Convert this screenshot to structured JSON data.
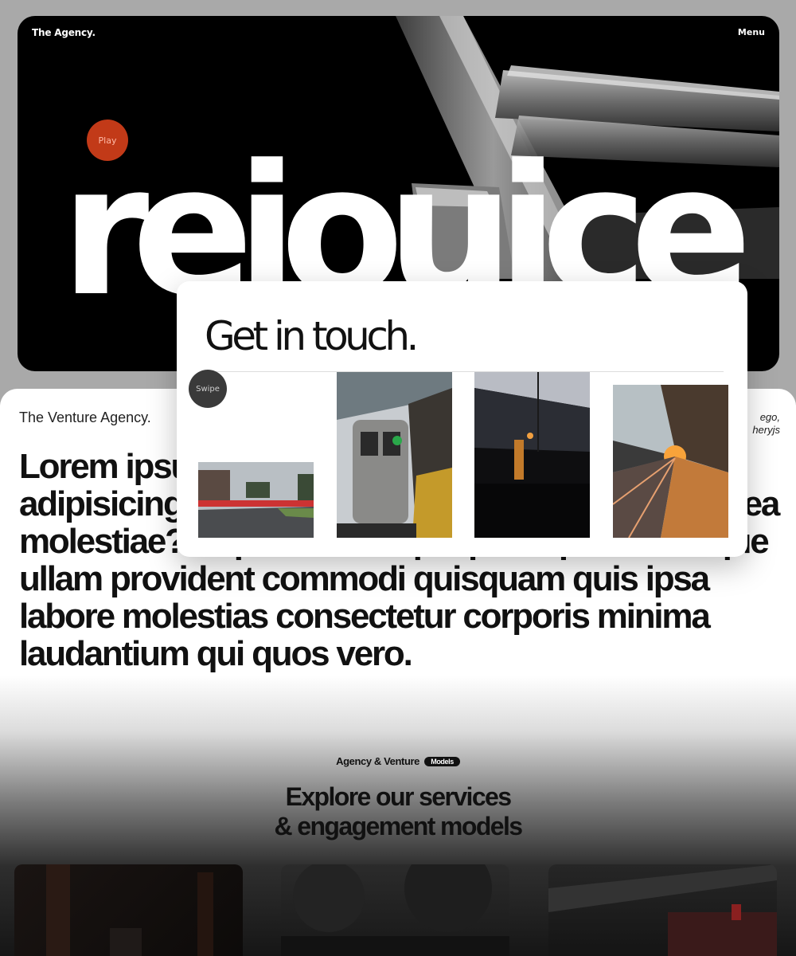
{
  "hero": {
    "logo": "The Agency.",
    "menu_label": "Menu",
    "play_label": "Play",
    "word": "rejouice"
  },
  "intro": {
    "venture_title": "The Venture Agency.",
    "side_note_line1": "ego,",
    "side_note_line2": "heryjs",
    "lead_text": "Lorem ipsum dolor sit amet consectetur adipisicing elit. Dolorem ratione veniam eveniet, ea molestiae? Repudiandae quo porro placeat itaque ullam provident commodi quisquam quis ipsa labore molestias consectetur corporis minima laudantium qui quos vero."
  },
  "services": {
    "tagline": "Agency & Venture",
    "badge": "Models",
    "heading_line1": "Explore our services",
    "heading_line2": "& engagement models"
  },
  "contact": {
    "title": "Get in touch.",
    "swipe_label": "Swipe"
  },
  "colors": {
    "accent": "#c23a18",
    "hero_bg": "#000000",
    "text_dark": "#111111"
  }
}
